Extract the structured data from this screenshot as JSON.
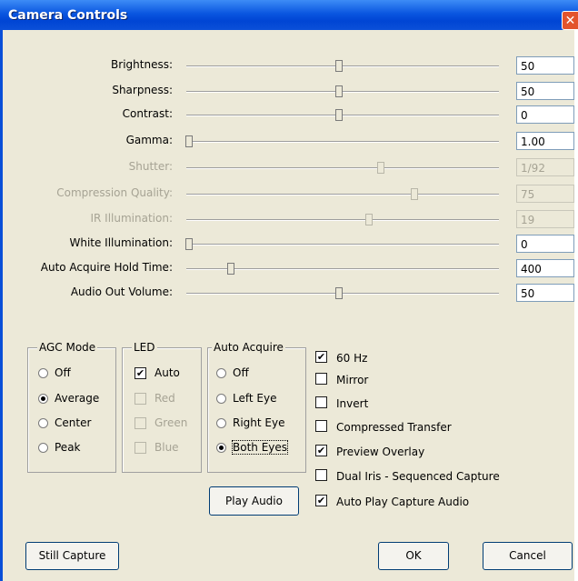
{
  "window": {
    "title": "Camera Controls",
    "close_glyph": "✕"
  },
  "sliders": [
    {
      "label": "Brightness:",
      "value": "50",
      "level": 0.5,
      "enabled": true
    },
    {
      "label": "Sharpness:",
      "value": "50",
      "level": 0.5,
      "enabled": true
    },
    {
      "label": "Contrast:",
      "value": "0",
      "level": 0.5,
      "enabled": true
    },
    {
      "label": "Gamma:",
      "value": "1.00",
      "level": 0.0,
      "enabled": true
    },
    {
      "label": "Shutter:",
      "value": "1/92",
      "level": 0.64,
      "enabled": false
    },
    {
      "label": "Compression Quality:",
      "value": "75",
      "level": 0.75,
      "enabled": false
    },
    {
      "label": "IR Illumination:",
      "value": "19",
      "level": 0.6,
      "enabled": false
    },
    {
      "label": "White Illumination:",
      "value": "0",
      "level": 0.0,
      "enabled": true
    },
    {
      "label": "Auto Acquire Hold Time:",
      "value": "400",
      "level": 0.14,
      "enabled": true
    },
    {
      "label": "Audio Out Volume:",
      "value": "50",
      "level": 0.5,
      "enabled": true
    }
  ],
  "agc_mode": {
    "title": "AGC Mode",
    "options": [
      "Off",
      "Average",
      "Center",
      "Peak"
    ],
    "selected": "Average"
  },
  "led": {
    "title": "LED",
    "options": [
      {
        "label": "Auto",
        "checked": true,
        "enabled": true
      },
      {
        "label": "Red",
        "checked": false,
        "enabled": false
      },
      {
        "label": "Green",
        "checked": false,
        "enabled": false
      },
      {
        "label": "Blue",
        "checked": false,
        "enabled": false
      }
    ]
  },
  "auto_acquire": {
    "title": "Auto Acquire",
    "options": [
      "Off",
      "Left Eye",
      "Right Eye",
      "Both Eyes"
    ],
    "selected": "Both Eyes"
  },
  "options": [
    {
      "label": "60 Hz",
      "checked": true
    },
    {
      "label": "Mirror",
      "checked": false
    },
    {
      "label": "Invert",
      "checked": false
    },
    {
      "label": "Compressed Transfer",
      "checked": false
    },
    {
      "label": "Preview Overlay",
      "checked": true
    },
    {
      "label": "Dual Iris - Sequenced Capture",
      "checked": false
    },
    {
      "label": "Auto Play Capture Audio",
      "checked": true
    }
  ],
  "buttons": {
    "play_audio": "Play Audio",
    "still_capture": "Still Capture",
    "ok": "OK",
    "cancel": "Cancel"
  },
  "glyphs": {
    "check": "✔"
  }
}
